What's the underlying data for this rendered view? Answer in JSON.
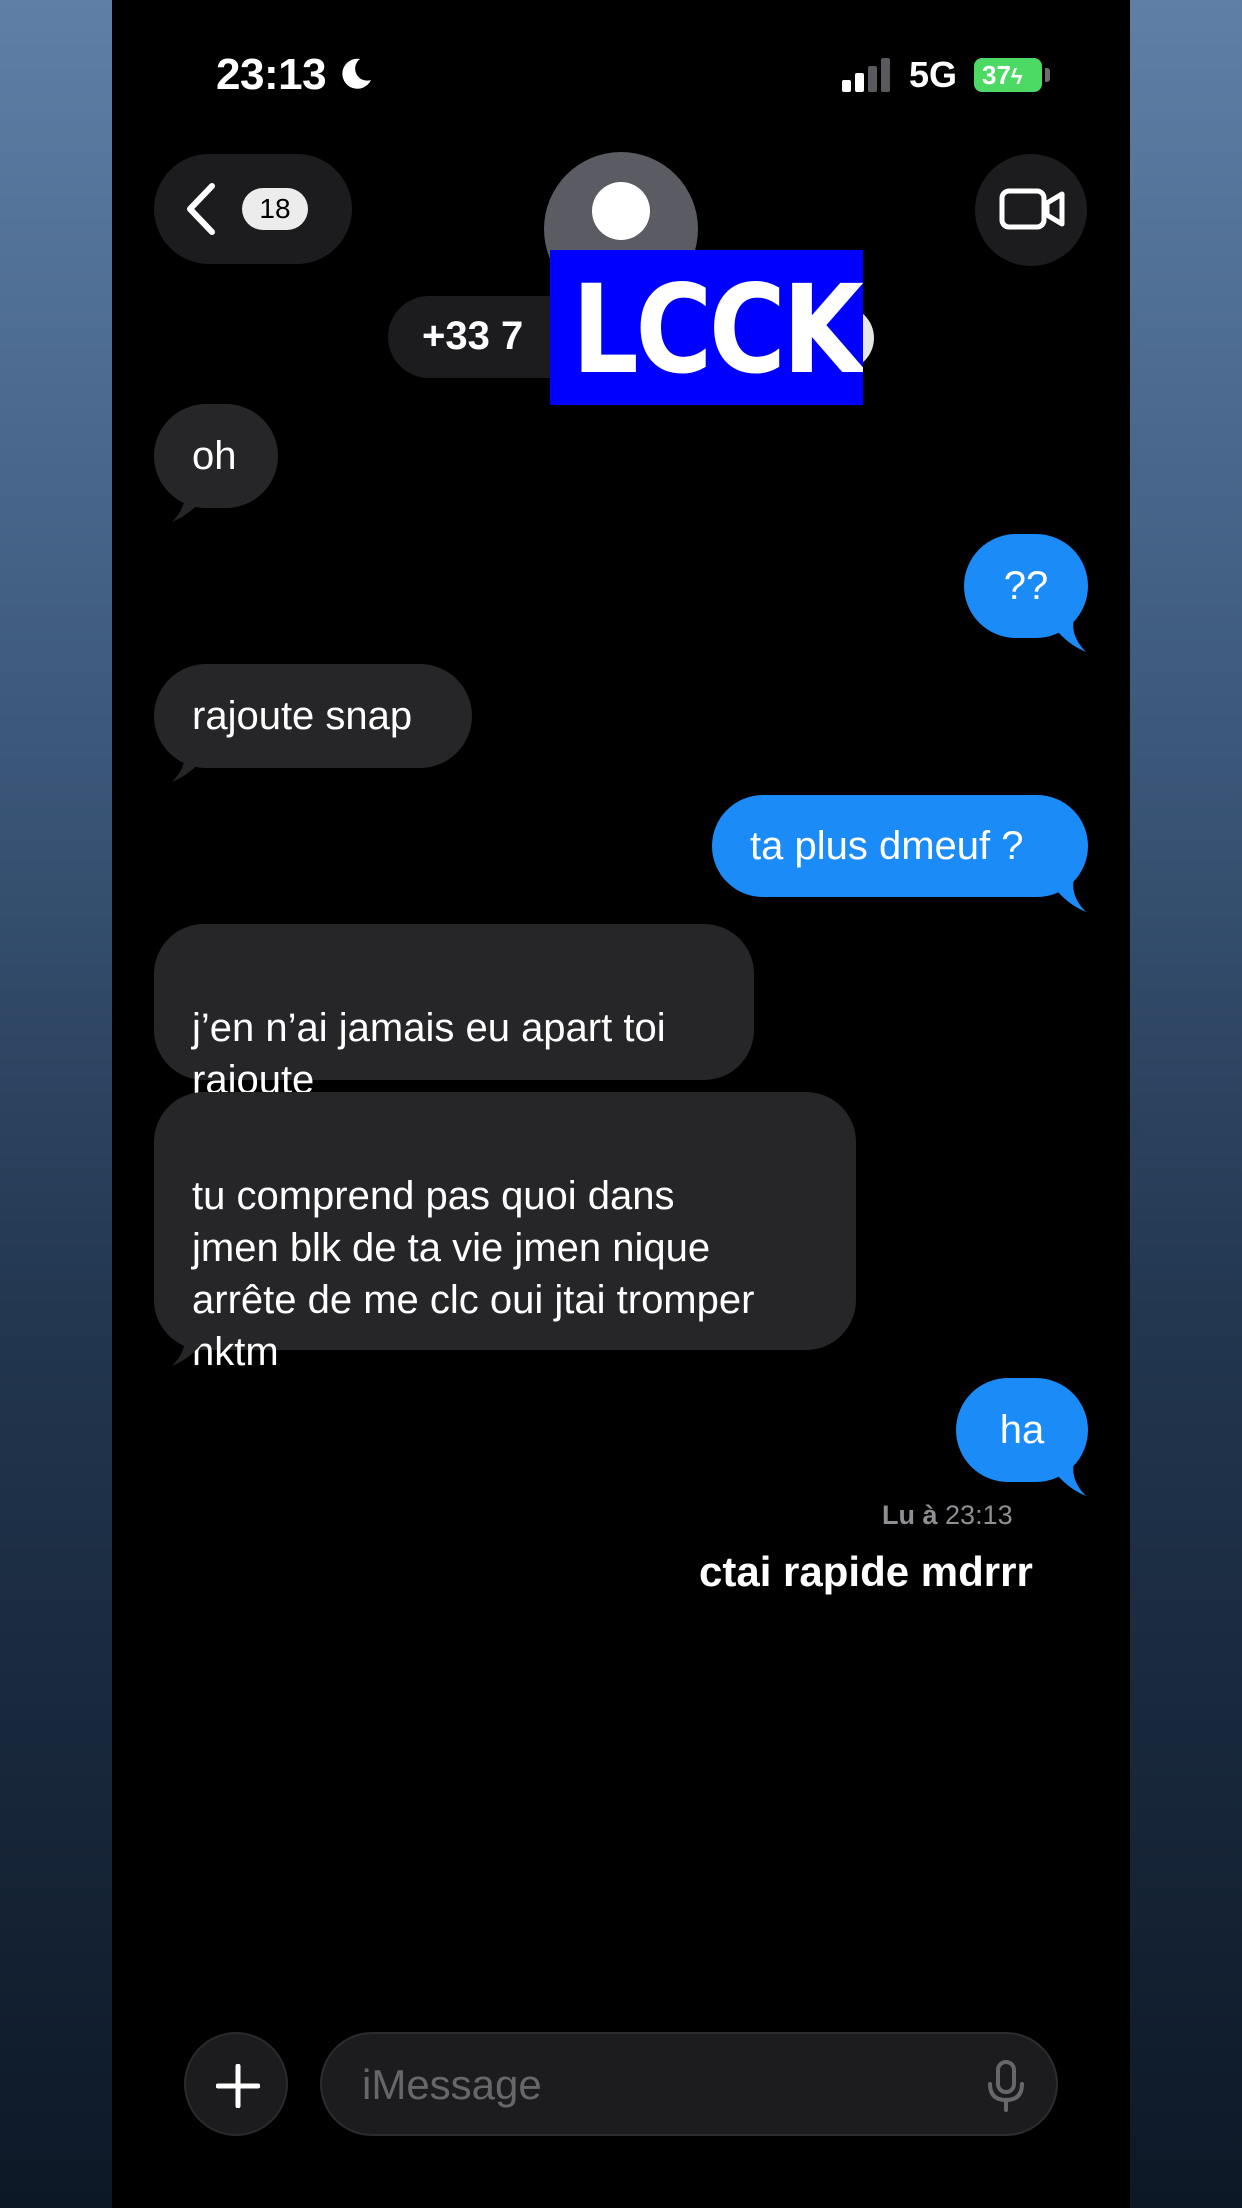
{
  "status_bar": {
    "time": "23:13",
    "network": "5G",
    "battery": "37"
  },
  "header": {
    "back_count": "18",
    "contact_name": "+33 7",
    "sticker_text": "LCCK"
  },
  "messages": [
    {
      "side": "received",
      "text": "oh"
    },
    {
      "side": "sent",
      "text": "??"
    },
    {
      "side": "received",
      "text": "rajoute snap"
    },
    {
      "side": "sent",
      "text": "ta plus dmeuf ?"
    },
    {
      "side": "received",
      "text": "j’en n’ai jamais eu apart toi\nrajoute"
    },
    {
      "side": "received",
      "text": "tu comprend pas quoi dans\njmen blk de ta vie jmen nique\narrête de me clc oui jtai tromper\nnktm"
    },
    {
      "side": "sent",
      "text": "ha"
    }
  ],
  "read_receipt": {
    "label": "Lu à",
    "time": "23:13"
  },
  "caption": "ctai rapide mdrrr",
  "composer": {
    "placeholder": "iMessage"
  },
  "colors": {
    "sent_bubble": "#1b8cf7",
    "received_bubble": "#262628",
    "background": "#000000"
  },
  "icons": [
    "moon-icon",
    "signal-icon",
    "battery-icon",
    "chevron-left-icon",
    "person-icon",
    "video-camera-icon",
    "plus-icon",
    "microphone-icon"
  ]
}
